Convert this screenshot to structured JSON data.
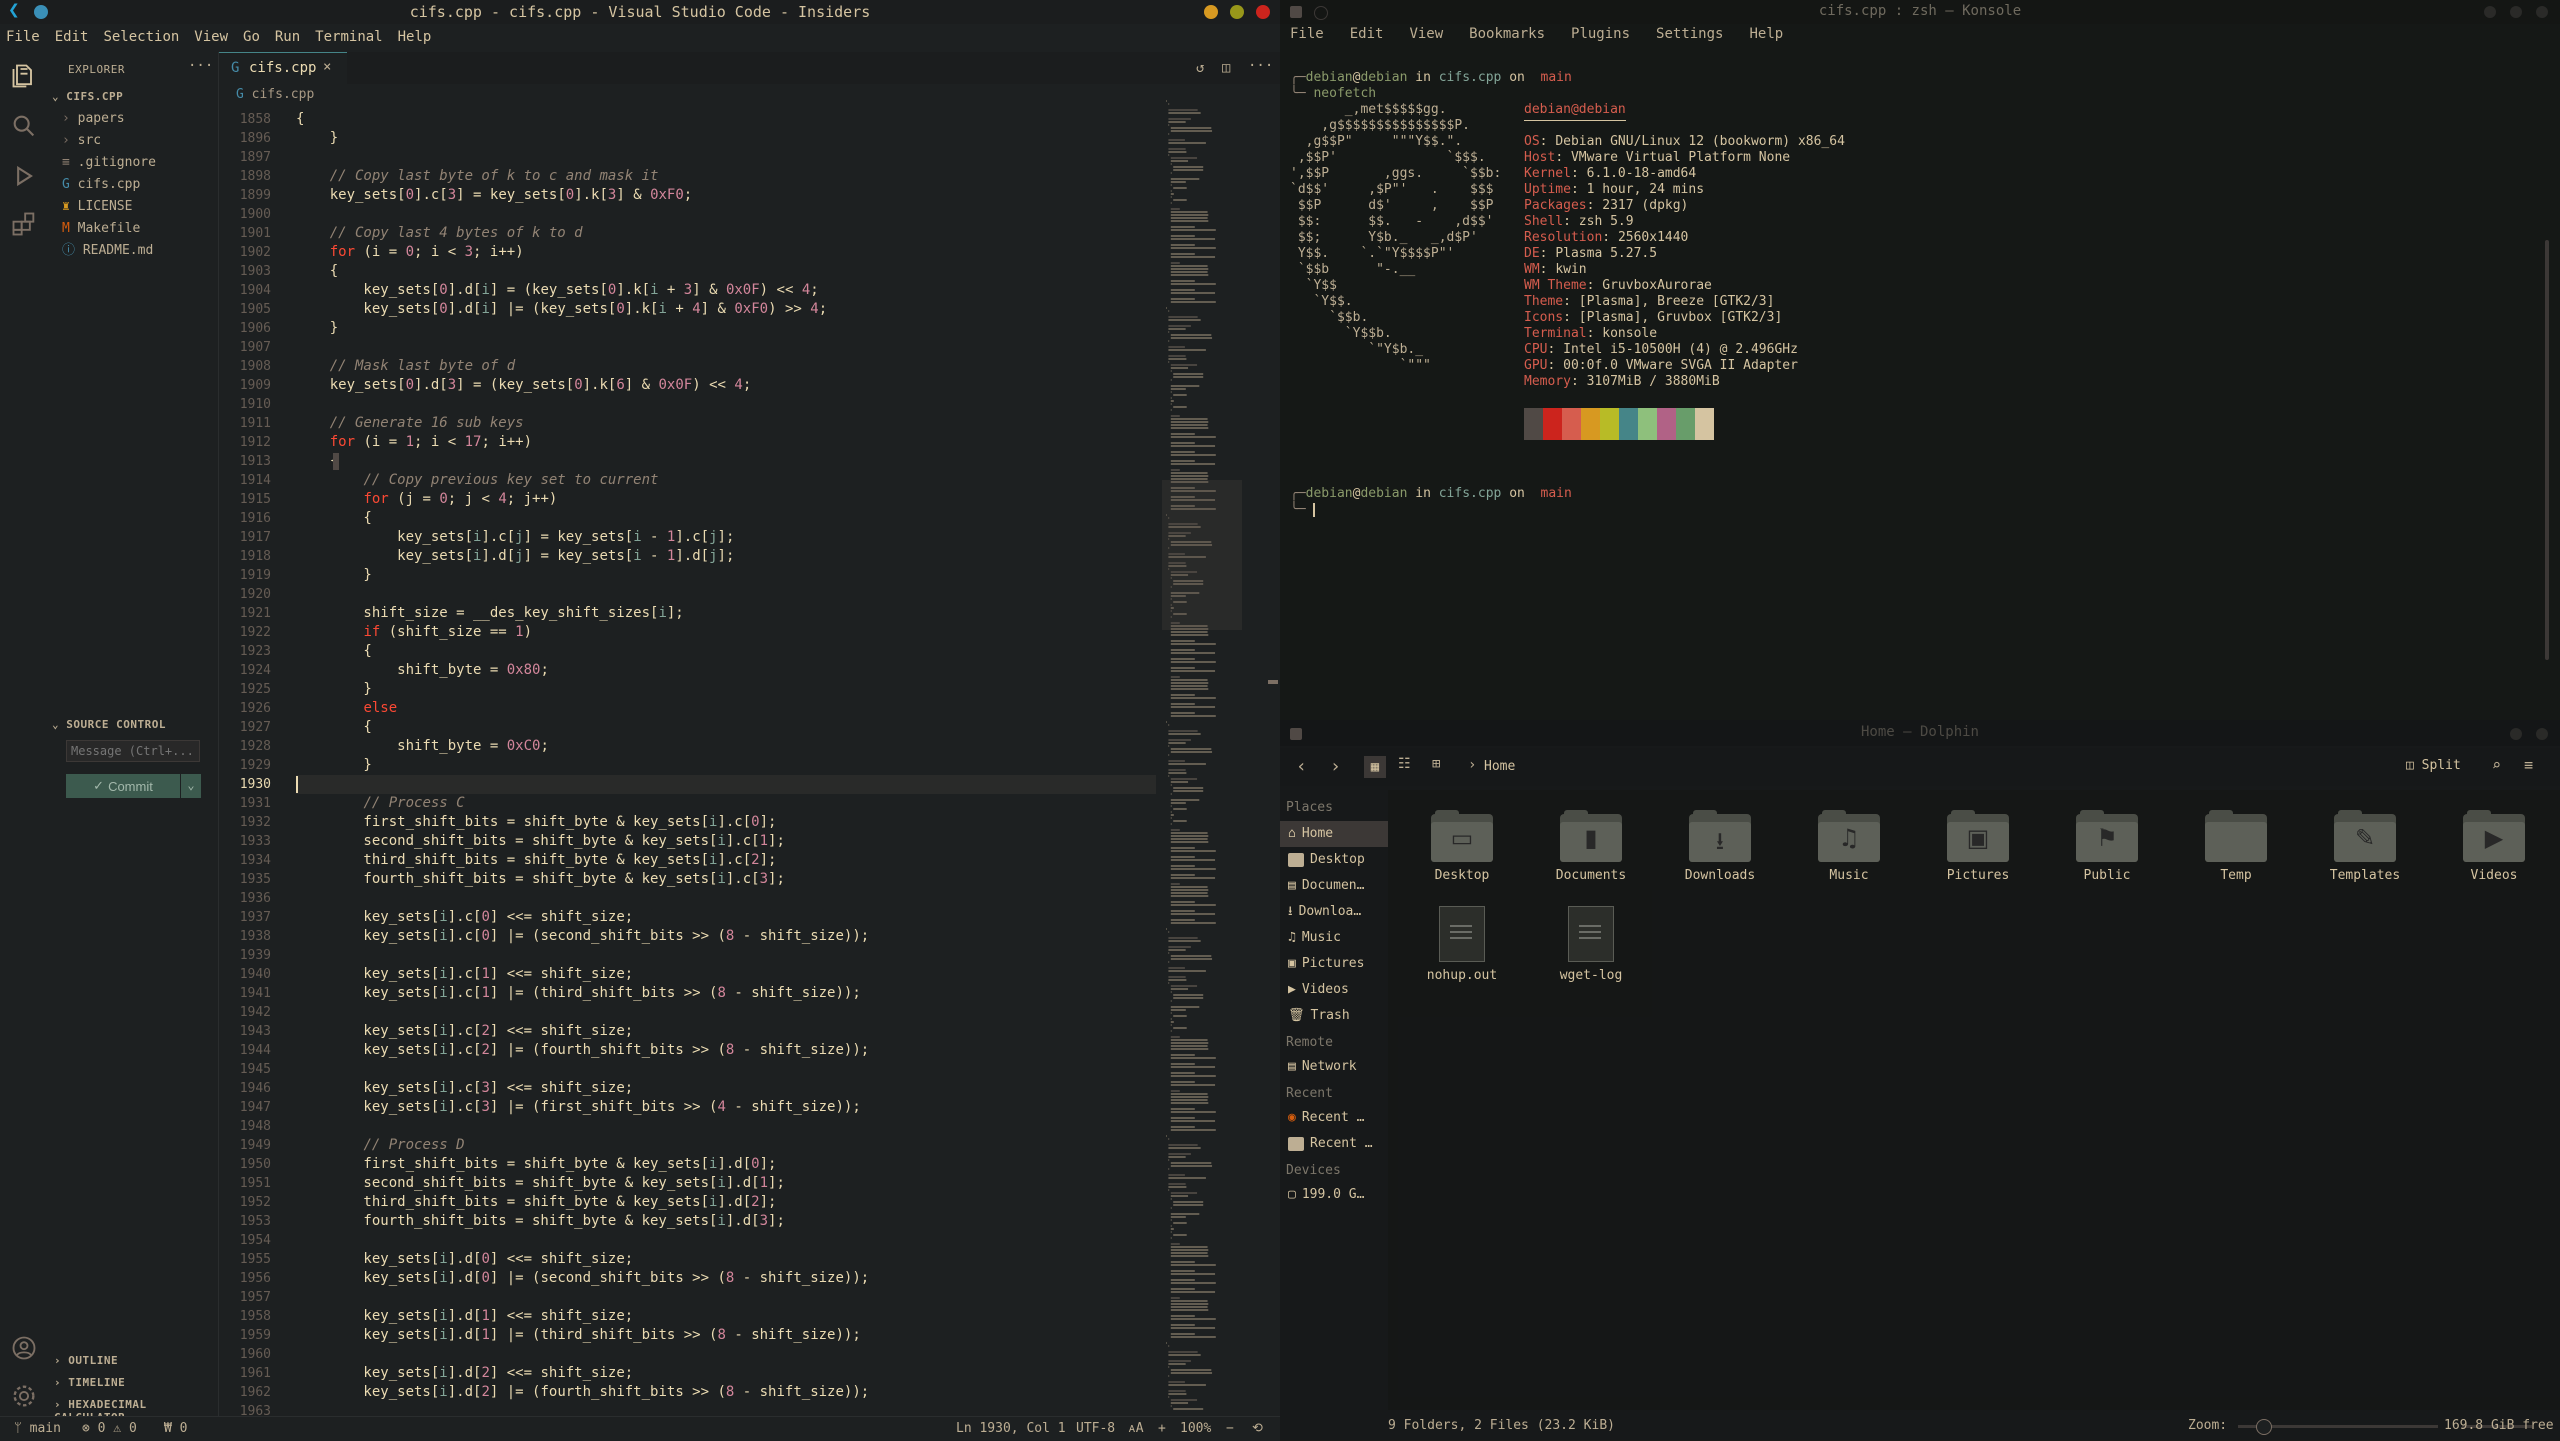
{
  "vscode": {
    "title": "cifs.cpp - cifs.cpp - Visual Studio Code - Insiders",
    "menu": [
      "File",
      "Edit",
      "Selection",
      "View",
      "Go",
      "Run",
      "Terminal",
      "Help"
    ],
    "explorer_label": "EXPLORER",
    "project": "CIFS.CPP",
    "tree": [
      {
        "label": "papers",
        "type": "folder"
      },
      {
        "label": "src",
        "type": "folder"
      },
      {
        "label": ".gitignore",
        "type": "file"
      },
      {
        "label": "cifs.cpp",
        "type": "cpp"
      },
      {
        "label": "LICENSE",
        "type": "license"
      },
      {
        "label": "Makefile",
        "type": "make"
      },
      {
        "label": "README.md",
        "type": "info"
      }
    ],
    "source_control_label": "SOURCE CONTROL",
    "message_placeholder": "Message (Ctrl+...",
    "commit_label": "Commit",
    "bottom_panels": [
      "OUTLINE",
      "TIMELINE",
      "HEXADECIMAL CALCULATOR"
    ],
    "tab": "cifs.cpp",
    "breadcrumb": "cifs.cpp",
    "current_line": "1930",
    "code_lines": [
      {
        "n": "1858",
        "t": "{"
      },
      {
        "n": "1896",
        "t": "    }"
      },
      {
        "n": "1897",
        "t": ""
      },
      {
        "n": "1898",
        "t": "    // Copy last byte of k to c and mask it"
      },
      {
        "n": "1899",
        "t": "    key_sets[0].c[3] = key_sets[0].k[3] & 0xF0;"
      },
      {
        "n": "1900",
        "t": ""
      },
      {
        "n": "1901",
        "t": "    // Copy last 4 bytes of k to d"
      },
      {
        "n": "1902",
        "t": "    for (i = 0; i < 3; i++)"
      },
      {
        "n": "1903",
        "t": "    {"
      },
      {
        "n": "1904",
        "t": "        key_sets[0].d[i] = (key_sets[0].k[i + 3] & 0x0F) << 4;"
      },
      {
        "n": "1905",
        "t": "        key_sets[0].d[i] |= (key_sets[0].k[i + 4] & 0xF0) >> 4;"
      },
      {
        "n": "1906",
        "t": "    }"
      },
      {
        "n": "1907",
        "t": ""
      },
      {
        "n": "1908",
        "t": "    // Mask last byte of d"
      },
      {
        "n": "1909",
        "t": "    key_sets[0].d[3] = (key_sets[0].k[6] & 0x0F) << 4;"
      },
      {
        "n": "1910",
        "t": ""
      },
      {
        "n": "1911",
        "t": "    // Generate 16 sub keys"
      },
      {
        "n": "1912",
        "t": "    for (i = 1; i < 17; i++)"
      },
      {
        "n": "1913",
        "t": "    {"
      },
      {
        "n": "1914",
        "t": "        // Copy previous key set to current"
      },
      {
        "n": "1915",
        "t": "        for (j = 0; j < 4; j++)"
      },
      {
        "n": "1916",
        "t": "        {"
      },
      {
        "n": "1917",
        "t": "            key_sets[i].c[j] = key_sets[i - 1].c[j];"
      },
      {
        "n": "1918",
        "t": "            key_sets[i].d[j] = key_sets[i - 1].d[j];"
      },
      {
        "n": "1919",
        "t": "        }"
      },
      {
        "n": "1920",
        "t": ""
      },
      {
        "n": "1921",
        "t": "        shift_size = __des_key_shift_sizes[i];"
      },
      {
        "n": "1922",
        "t": "        if (shift_size == 1)"
      },
      {
        "n": "1923",
        "t": "        {"
      },
      {
        "n": "1924",
        "t": "            shift_byte = 0x80;"
      },
      {
        "n": "1925",
        "t": "        }"
      },
      {
        "n": "1926",
        "t": "        else"
      },
      {
        "n": "1927",
        "t": "        {"
      },
      {
        "n": "1928",
        "t": "            shift_byte = 0xC0;"
      },
      {
        "n": "1929",
        "t": "        }"
      },
      {
        "n": "1930",
        "t": ""
      },
      {
        "n": "1931",
        "t": "        // Process C"
      },
      {
        "n": "1932",
        "t": "        first_shift_bits = shift_byte & key_sets[i].c[0];"
      },
      {
        "n": "1933",
        "t": "        second_shift_bits = shift_byte & key_sets[i].c[1];"
      },
      {
        "n": "1934",
        "t": "        third_shift_bits = shift_byte & key_sets[i].c[2];"
      },
      {
        "n": "1935",
        "t": "        fourth_shift_bits = shift_byte & key_sets[i].c[3];"
      },
      {
        "n": "1936",
        "t": ""
      },
      {
        "n": "1937",
        "t": "        key_sets[i].c[0] <<= shift_size;"
      },
      {
        "n": "1938",
        "t": "        key_sets[i].c[0] |= (second_shift_bits >> (8 - shift_size));"
      },
      {
        "n": "1939",
        "t": ""
      },
      {
        "n": "1940",
        "t": "        key_sets[i].c[1] <<= shift_size;"
      },
      {
        "n": "1941",
        "t": "        key_sets[i].c[1] |= (third_shift_bits >> (8 - shift_size));"
      },
      {
        "n": "1942",
        "t": ""
      },
      {
        "n": "1943",
        "t": "        key_sets[i].c[2] <<= shift_size;"
      },
      {
        "n": "1944",
        "t": "        key_sets[i].c[2] |= (fourth_shift_bits >> (8 - shift_size));"
      },
      {
        "n": "1945",
        "t": ""
      },
      {
        "n": "1946",
        "t": "        key_sets[i].c[3] <<= shift_size;"
      },
      {
        "n": "1947",
        "t": "        key_sets[i].c[3] |= (first_shift_bits >> (4 - shift_size));"
      },
      {
        "n": "1948",
        "t": ""
      },
      {
        "n": "1949",
        "t": "        // Process D"
      },
      {
        "n": "1950",
        "t": "        first_shift_bits = shift_byte & key_sets[i].d[0];"
      },
      {
        "n": "1951",
        "t": "        second_shift_bits = shift_byte & key_sets[i].d[1];"
      },
      {
        "n": "1952",
        "t": "        third_shift_bits = shift_byte & key_sets[i].d[2];"
      },
      {
        "n": "1953",
        "t": "        fourth_shift_bits = shift_byte & key_sets[i].d[3];"
      },
      {
        "n": "1954",
        "t": ""
      },
      {
        "n": "1955",
        "t": "        key_sets[i].d[0] <<= shift_size;"
      },
      {
        "n": "1956",
        "t": "        key_sets[i].d[0] |= (second_shift_bits >> (8 - shift_size));"
      },
      {
        "n": "1957",
        "t": ""
      },
      {
        "n": "1958",
        "t": "        key_sets[i].d[1] <<= shift_size;"
      },
      {
        "n": "1959",
        "t": "        key_sets[i].d[1] |= (third_shift_bits >> (8 - shift_size));"
      },
      {
        "n": "1960",
        "t": ""
      },
      {
        "n": "1961",
        "t": "        key_sets[i].d[2] <<= shift_size;"
      },
      {
        "n": "1962",
        "t": "        key_sets[i].d[2] |= (fourth_shift_bits >> (8 - shift_size));"
      },
      {
        "n": "1963",
        "t": ""
      }
    ],
    "status": {
      "branch": "main",
      "problems": "⊗ 0 ⚠ 0",
      "ports": "₩ 0",
      "position": "Ln 1930, Col 1",
      "encoding": "UTF-8",
      "zoom": "100%"
    }
  },
  "konsole": {
    "title": "cifs.cpp : zsh — Konsole",
    "menu": [
      "File",
      "Edit",
      "View",
      "Bookmarks",
      "Plugins",
      "Settings",
      "Help"
    ],
    "prompt": {
      "user": "debian",
      "at": "@",
      "host": "debian",
      "in": "in",
      "dir": "cifs.cpp",
      "on": "on",
      "branch": "main"
    },
    "command": "neofetch",
    "ascii": [
      "       _,met$$$$$gg.",
      "    ,g$$$$$$$$$$$$$$$P.",
      "  ,g$$P\"     \"\"\"Y$$.\".",
      " ,$$P'              `$$$.",
      "',$$P       ,ggs.     `$$b:",
      "`d$$'     ,$P\"'   .    $$$",
      " $$P      d$'     ,    $$P",
      " $$:      $$.   -    ,d$$'",
      " $$;      Y$b._   _,d$P'",
      " Y$$.    `.`\"Y$$$$P\"'",
      " `$$b      \"-.__",
      "  `Y$$",
      "   `Y$$.",
      "     `$$b.",
      "       `Y$$b.",
      "          `\"Y$b._",
      "              `\"\"\""
    ],
    "header": "debian@debian",
    "info": [
      {
        "k": "OS",
        "v": "Debian GNU/Linux 12 (bookworm) x86_64"
      },
      {
        "k": "Host",
        "v": "VMware Virtual Platform None"
      },
      {
        "k": "Kernel",
        "v": "6.1.0-18-amd64"
      },
      {
        "k": "Uptime",
        "v": "1 hour, 24 mins"
      },
      {
        "k": "Packages",
        "v": "2317 (dpkg)"
      },
      {
        "k": "Shell",
        "v": "zsh 5.9"
      },
      {
        "k": "Resolution",
        "v": "2560x1440"
      },
      {
        "k": "DE",
        "v": "Plasma 5.27.5"
      },
      {
        "k": "WM",
        "v": "kwin"
      },
      {
        "k": "WM Theme",
        "v": "GruvboxAurorae"
      },
      {
        "k": "Theme",
        "v": "[Plasma], Breeze [GTK2/3]"
      },
      {
        "k": "Icons",
        "v": "[Plasma], Gruvbox [GTK2/3]"
      },
      {
        "k": "Terminal",
        "v": "konsole"
      },
      {
        "k": "CPU",
        "v": "Intel i5-10500H (4) @ 2.496GHz"
      },
      {
        "k": "GPU",
        "v": "00:0f.0 VMware SVGA II Adapter"
      },
      {
        "k": "Memory",
        "v": "3107MiB / 3880MiB"
      }
    ],
    "palette": [
      "#504945",
      "#cc241d",
      "#d65d4e",
      "#d79921",
      "#b8bb26",
      "#458588",
      "#8ec07c",
      "#b16286",
      "#689d6a",
      "#d5c4a1"
    ]
  },
  "dolphin": {
    "title": "Home — Dolphin",
    "breadcrumb": "Home",
    "split_label": "Split",
    "places_header": "Places",
    "places": [
      "Home",
      "Desktop",
      "Documen…",
      "Downloa…",
      "Music",
      "Pictures",
      "Videos",
      "Trash"
    ],
    "remote_header": "Remote",
    "remote": [
      "Network"
    ],
    "recent_header": "Recent",
    "recent": [
      "Recent …",
      "Recent …"
    ],
    "devices_header": "Devices",
    "devices": [
      "199.0 G…"
    ],
    "folders": [
      {
        "label": "Desktop",
        "glyph": "▭"
      },
      {
        "label": "Documents",
        "glyph": "▮"
      },
      {
        "label": "Downloads",
        "glyph": "⭳"
      },
      {
        "label": "Music",
        "glyph": "♫"
      },
      {
        "label": "Pictures",
        "glyph": "▣"
      },
      {
        "label": "Public",
        "glyph": "⚑"
      },
      {
        "label": "Temp",
        "glyph": ""
      },
      {
        "label": "Templates",
        "glyph": "✎"
      },
      {
        "label": "Videos",
        "glyph": "▶"
      }
    ],
    "files": [
      "nohup.out",
      "wget-log"
    ],
    "status_left": "9 Folders, 2 Files (23.2 KiB)",
    "zoom_label": "Zoom:",
    "free": "169.8 GiB free"
  }
}
